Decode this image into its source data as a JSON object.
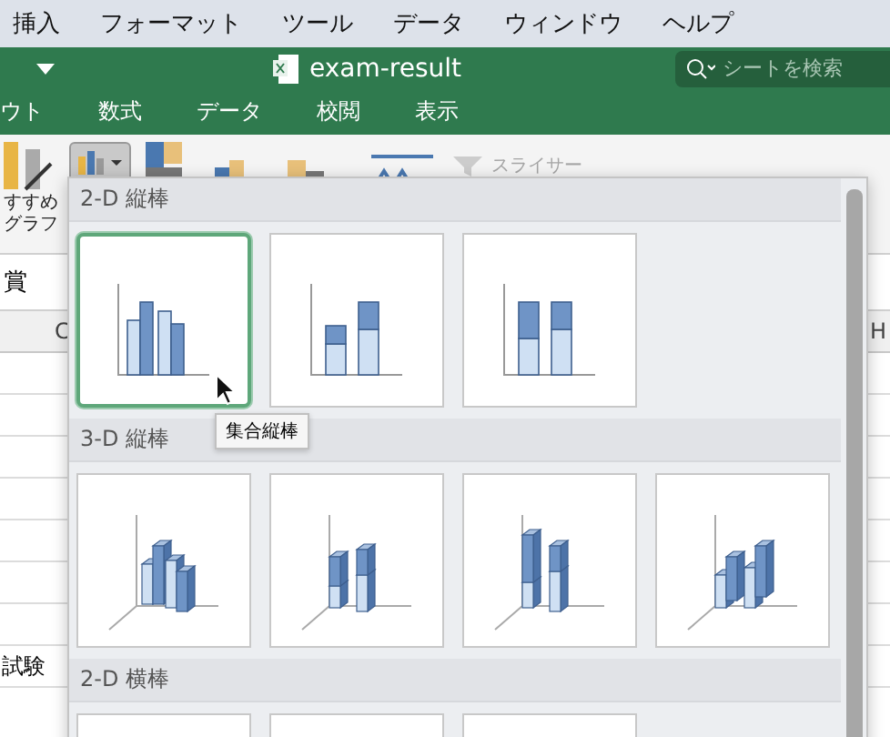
{
  "menu_bar": {
    "items": [
      "挿入",
      "フォーマット",
      "ツール",
      "データ",
      "ウィンドウ",
      "ヘルプ"
    ]
  },
  "title_bar": {
    "title": "exam-result",
    "search": {
      "placeholder": "シートを検索"
    }
  },
  "ribbon_tabs": [
    {
      "label": "ウト",
      "selected": false
    },
    {
      "label": "数式",
      "selected": false
    },
    {
      "label": "データ",
      "selected": false
    },
    {
      "label": "校閲",
      "selected": false
    },
    {
      "label": "表示",
      "selected": false
    }
  ],
  "ribbon": {
    "recommended_chart_label": [
      "すすめ",
      "グラフ"
    ],
    "column_chart_pressed": true,
    "slicer": {
      "label": "スライサー",
      "disabled": true
    }
  },
  "sheet": {
    "cell_text": "賞",
    "column_headers": [
      "C",
      "H"
    ],
    "row_text": "試験"
  },
  "gallery": {
    "sections": [
      {
        "title": "2-D 縦棒",
        "items": [
          {
            "kind": "clustered",
            "selected": true
          },
          {
            "kind": "stacked",
            "selected": false
          },
          {
            "kind": "stacked100",
            "selected": false
          }
        ]
      },
      {
        "title": "3-D 縦棒",
        "items": [
          {
            "kind": "clustered3d",
            "selected": false
          },
          {
            "kind": "stacked3d",
            "selected": false
          },
          {
            "kind": "stacked100_3d",
            "selected": false
          },
          {
            "kind": "column3d",
            "selected": false
          }
        ]
      },
      {
        "title": "2-D 横棒",
        "items": [
          {
            "kind": "bar",
            "selected": false
          },
          {
            "kind": "bar",
            "selected": false
          },
          {
            "kind": "bar",
            "selected": false
          }
        ]
      }
    ],
    "tooltip": "集合縦棒"
  }
}
